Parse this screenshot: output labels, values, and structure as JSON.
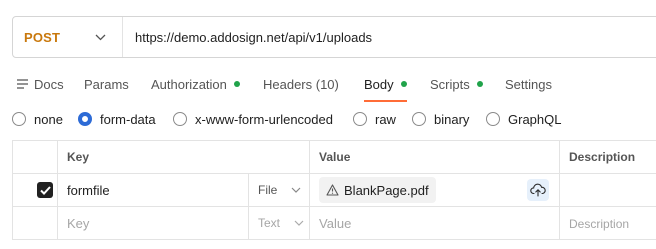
{
  "request": {
    "method": "POST",
    "url": "https://demo.addosign.net/api/v1/uploads"
  },
  "tabs": [
    {
      "label": "Docs",
      "icon": "doc-icon"
    },
    {
      "label": "Params"
    },
    {
      "label": "Authorization",
      "dot": true
    },
    {
      "label": "Headers (10)"
    },
    {
      "label": "Body",
      "dot": true,
      "active": true
    },
    {
      "label": "Scripts",
      "dot": true
    },
    {
      "label": "Settings"
    }
  ],
  "body_types": [
    {
      "label": "none",
      "checked": false
    },
    {
      "label": "form-data",
      "checked": true
    },
    {
      "label": "x-www-form-urlencoded",
      "checked": false
    },
    {
      "label": "raw",
      "checked": false
    },
    {
      "label": "binary",
      "checked": false
    },
    {
      "label": "GraphQL",
      "checked": false
    }
  ],
  "table": {
    "headers": {
      "key": "Key",
      "value": "Value",
      "description": "Description"
    },
    "rows": [
      {
        "checked": true,
        "key": "formfile",
        "type": "File",
        "value": "BlankPage.pdf",
        "description": ""
      }
    ],
    "new_row": {
      "key_placeholder": "Key",
      "type": "Text",
      "value_placeholder": "Value",
      "description_placeholder": "Description"
    }
  },
  "colors": {
    "method": "#c9780c",
    "active_tab_underline": "#ff6c37",
    "status_dot": "#20a34a",
    "radio_checked": "#2d6bd6"
  }
}
